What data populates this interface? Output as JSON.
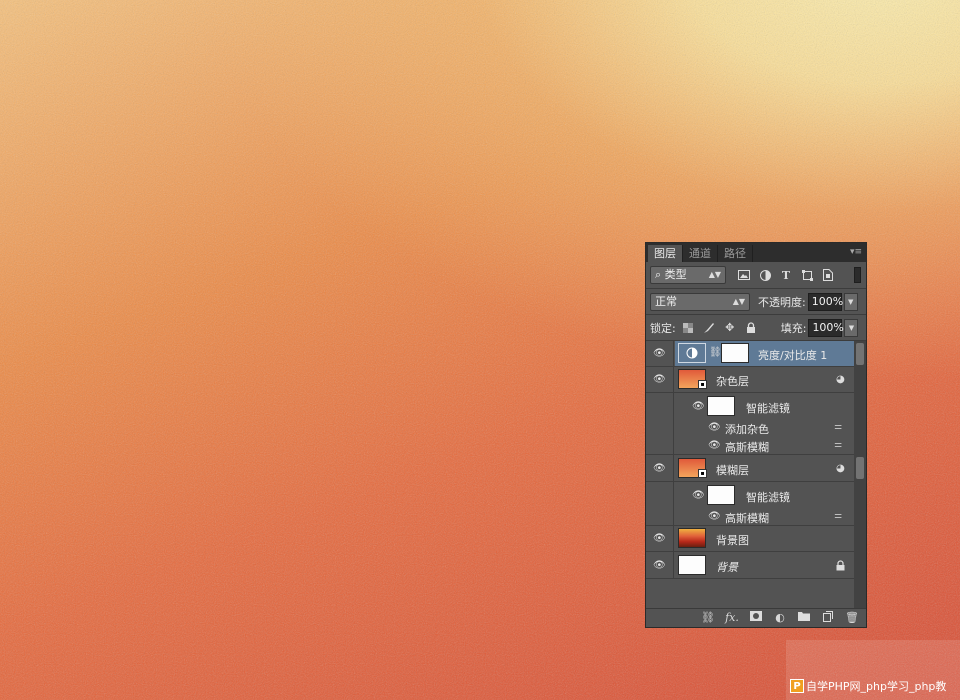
{
  "panel": {
    "tabs": [
      "图层",
      "通道",
      "路径"
    ],
    "active_tab": 0,
    "filter": {
      "kind_label": "类型",
      "icons": [
        "image-filter-icon",
        "adjustment-filter-icon",
        "type-filter-icon",
        "shape-filter-icon",
        "smart-object-filter-icon"
      ]
    },
    "blend_mode": "正常",
    "opacity_label": "不透明度:",
    "opacity_value": "100%",
    "lock_label": "锁定:",
    "fill_label": "填充:",
    "fill_value": "100%"
  },
  "layers": [
    {
      "name": "亮度/对比度 1",
      "type": "adjustment",
      "selected": true
    },
    {
      "name": "杂色层",
      "type": "smart-object"
    },
    {
      "name": "智能滤镜",
      "type": "smart-filters"
    },
    {
      "name": "添加杂色",
      "type": "filter"
    },
    {
      "name": "高斯模糊",
      "type": "filter"
    },
    {
      "name": "模糊层",
      "type": "smart-object"
    },
    {
      "name": "智能滤镜",
      "type": "smart-filters"
    },
    {
      "name": "高斯模糊",
      "type": "filter"
    },
    {
      "name": "背景图",
      "type": "image"
    },
    {
      "name": "背景",
      "type": "background",
      "locked": true
    }
  ],
  "footer_icons": [
    "link-layers-icon",
    "fx-icon",
    "add-mask-icon",
    "adjustment-layer-icon",
    "new-group-icon",
    "new-layer-icon",
    "delete-layer-icon"
  ],
  "watermark": {
    "logo": "P",
    "text": "自学PHP网_php学习_php教"
  },
  "colors": {
    "panel_bg": "#535353",
    "selected_row": "#5f7a96",
    "tab_bar": "#2d2d2d"
  }
}
